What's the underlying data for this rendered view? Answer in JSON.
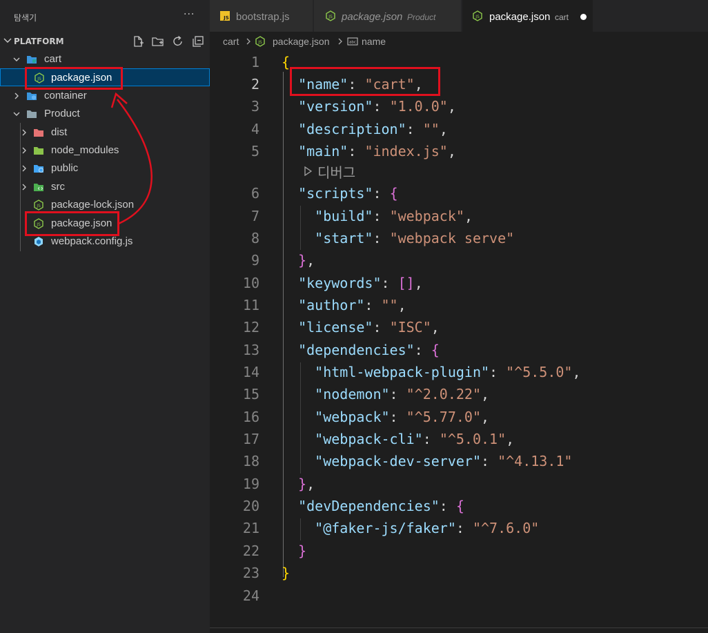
{
  "sidebar": {
    "title": "탐색기",
    "more_label": "···",
    "section_title": "PLATFORM",
    "section_actions": [
      "new-file-icon",
      "new-folder-icon",
      "refresh-icon",
      "collapse-all-icon"
    ],
    "tree": [
      {
        "label": "cart",
        "type": "folder",
        "expanded": true,
        "selected": false,
        "icon": "folder-icon"
      },
      {
        "label": "package.json",
        "type": "file",
        "selected": true,
        "icon": "nodejs-icon"
      },
      {
        "label": "container",
        "type": "folder",
        "expanded": false,
        "selected": false,
        "icon": "folder-icon"
      },
      {
        "label": "Product",
        "type": "folder",
        "expanded": true,
        "selected": false,
        "icon": "folder-icon"
      },
      {
        "label": "dist",
        "type": "folder",
        "expanded": false,
        "selected": false,
        "icon": "folder-dist-icon"
      },
      {
        "label": "node_modules",
        "type": "folder",
        "expanded": false,
        "selected": false,
        "icon": "folder-node-icon"
      },
      {
        "label": "public",
        "type": "folder",
        "expanded": false,
        "selected": false,
        "icon": "folder-public-icon"
      },
      {
        "label": "src",
        "type": "folder",
        "expanded": false,
        "selected": false,
        "icon": "folder-src-icon"
      },
      {
        "label": "package-lock.json",
        "type": "file",
        "selected": false,
        "icon": "nodejs-icon"
      },
      {
        "label": "package.json",
        "type": "file",
        "selected": false,
        "icon": "nodejs-icon"
      },
      {
        "label": "webpack.config.js",
        "type": "file",
        "selected": false,
        "icon": "webpack-icon"
      }
    ]
  },
  "tabs": [
    {
      "label": "bootstrap.js",
      "description": "",
      "italic": false,
      "active": false,
      "dirty": false,
      "icon": "js-icon"
    },
    {
      "label": "package.json",
      "description": "Product",
      "italic": true,
      "active": false,
      "dirty": false,
      "icon": "nodejs-icon"
    },
    {
      "label": "package.json",
      "description": "cart",
      "italic": false,
      "active": true,
      "dirty": true,
      "icon": "nodejs-icon"
    }
  ],
  "breadcrumb": {
    "items": [
      "cart",
      "package.json",
      "name"
    ]
  },
  "editor": {
    "current_line": 2,
    "codelens_label": "디버그",
    "line_numbers": [
      "1",
      "2",
      "3",
      "4",
      "5",
      "6",
      "7",
      "8",
      "9",
      "10",
      "11",
      "12",
      "13",
      "14",
      "15",
      "16",
      "17",
      "18",
      "19",
      "20",
      "21",
      "22",
      "23",
      "24"
    ],
    "lines": [
      "{",
      "  \"name\": \"cart\",",
      "  \"version\": \"1.0.0\",",
      "  \"description\": \"\",",
      "  \"main\": \"index.js\",",
      "  \"scripts\": {",
      "    \"build\": \"webpack\",",
      "    \"start\": \"webpack serve\"",
      "  },",
      "  \"keywords\": [],",
      "  \"author\": \"\",",
      "  \"license\": \"ISC\",",
      "  \"dependencies\": {",
      "    \"html-webpack-plugin\": \"^5.5.0\",",
      "    \"nodemon\": \"^2.0.22\",",
      "    \"webpack\": \"^5.77.0\",",
      "    \"webpack-cli\": \"^5.0.1\",",
      "    \"webpack-dev-server\": \"^4.13.1\"",
      "  },",
      "  \"devDependencies\": {",
      "    \"@faker-js/faker\": \"^7.6.0\"",
      "  }",
      "}",
      ""
    ]
  },
  "colors": {
    "accent": "#007fd4",
    "annotation": "#e0101e",
    "json_key": "#9cdcfe",
    "json_string": "#ce9178",
    "bracket_level1": "#ffd700",
    "bracket_level2": "#da70d6",
    "bracket_level3": "#179fff"
  }
}
